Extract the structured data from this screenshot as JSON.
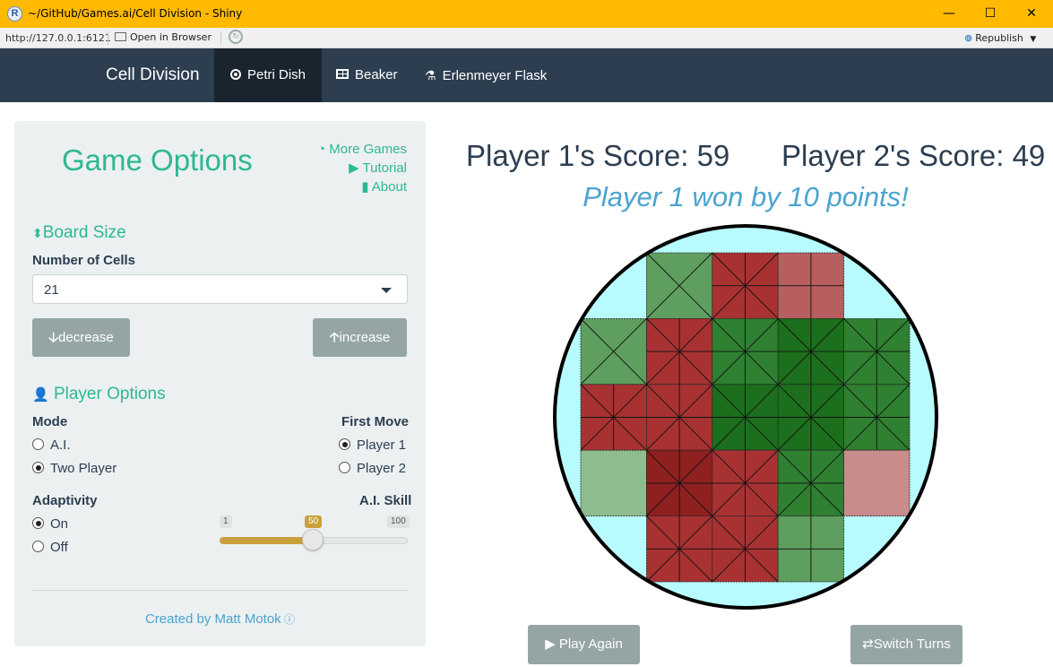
{
  "window": {
    "title": "~/GitHub/Games.ai/Cell Division - Shiny",
    "minimize": "—",
    "maximize": "☐",
    "close": "✕"
  },
  "addressbar": {
    "url": "http://127.0.0.1:6121",
    "open_browser": "Open in Browser",
    "republish": "Republish"
  },
  "navbar": {
    "brand": "Cell Division",
    "tabs": [
      {
        "label": "Petri Dish",
        "icon": "target-icon"
      },
      {
        "label": "Beaker",
        "icon": "table-icon"
      },
      {
        "label": "Erlenmeyer Flask",
        "icon": "flask-icon"
      }
    ]
  },
  "sidebar": {
    "title": "Game Options",
    "links": [
      "More Games",
      "Tutorial",
      "About"
    ],
    "board_size": {
      "heading": "Board Size",
      "cells_label": "Number of Cells",
      "cells_value": "21",
      "decrease_label": "decrease",
      "increase_label": "increase"
    },
    "player_options": {
      "heading": "Player Options",
      "mode_label": "Mode",
      "mode_options": [
        "A.I.",
        "Two Player"
      ],
      "mode_selected": "Two Player",
      "first_move_label": "First Move",
      "first_move_options": [
        "Player 1",
        "Player 2"
      ],
      "first_move_selected": "Player 1",
      "adaptivity_label": "Adaptivity",
      "adaptivity_options": [
        "On",
        "Off"
      ],
      "adaptivity_selected": "On",
      "skill_label": "A.I. Skill",
      "skill_min": "1",
      "skill_max": "100",
      "skill_value": "50"
    },
    "credit": "Created by Matt Motok"
  },
  "main": {
    "p1_score": "Player 1's Score: 59",
    "p2_score": "Player 2's Score: 49",
    "result": "Player 1 won by 10 points!",
    "play_again": "Play Again",
    "switch_turns": "Switch Turns"
  },
  "colors": {
    "navbar": "#2c3e50",
    "accent": "#2db894",
    "dish": "#b8fbff",
    "player1": "#8b1a1a",
    "player2": "#1e7a1e"
  }
}
